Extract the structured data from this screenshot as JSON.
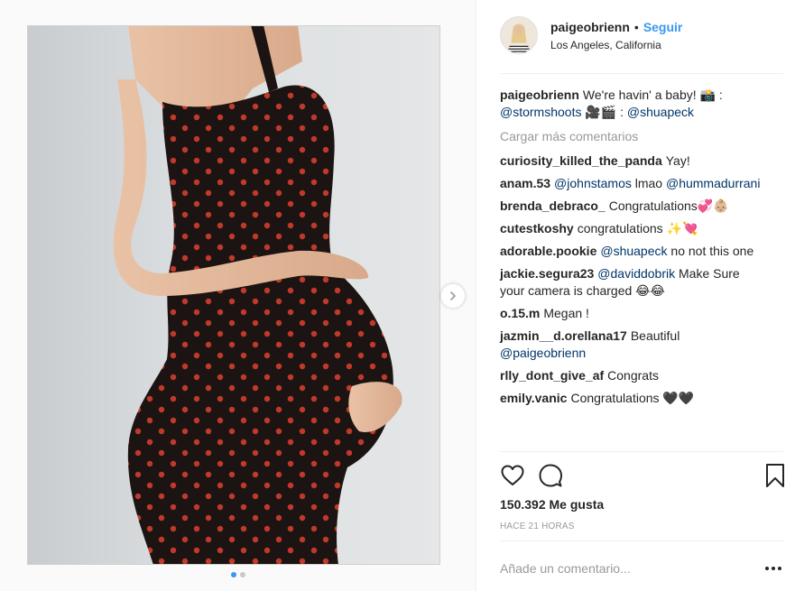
{
  "header": {
    "username": "paigeobrienn",
    "separator": "•",
    "follow_label": "Seguir",
    "location": "Los Angeles, California"
  },
  "caption": {
    "user": "paigeobrienn",
    "text": "We're havin' a baby! 📸 :",
    "mention1": "@stormshoots",
    "middle": " 🎥🎬 : ",
    "mention2": "@shuapeck"
  },
  "load_more_label": "Cargar más comentarios",
  "comments": [
    {
      "user": "curiosity_killed_the_panda",
      "text": "Yay!"
    },
    {
      "user": "anam.53",
      "mention": "@johnstamos",
      "text": " lmao ",
      "mention2": "@hummadurrani"
    },
    {
      "user": "brenda_debraco_",
      "text": "Congratulations💞👶🏼"
    },
    {
      "user": "cutestkoshy",
      "text": "congratulations ✨💘"
    },
    {
      "user": "adorable.pookie",
      "mention": "@shuapeck",
      "text": " no not this one"
    },
    {
      "user": "jackie.segura23",
      "mention": "@daviddobrik",
      "text": " Make Sure your camera is charged 😂😂"
    },
    {
      "user": "o.15.m",
      "text": "Megan !"
    },
    {
      "user": "jazmin__d.orellana17",
      "text": "Beautiful ",
      "mention": "@paigeobrienn"
    },
    {
      "user": "rlly_dont_give_af",
      "text": "Congrats"
    },
    {
      "user": "emily.vanic",
      "text": "Congratulations 🖤🖤"
    }
  ],
  "likes_label": "150.392 Me gusta",
  "time_label": "HACE 21 HORAS",
  "add_comment_placeholder": "Añade un comentario...",
  "carousel": {
    "count": 2,
    "active": 0
  },
  "icons": [
    "heart-icon",
    "comment-icon",
    "bookmark-icon",
    "chevron-right-icon",
    "more-icon"
  ],
  "colors": {
    "link": "#3897f0",
    "mention": "#003569",
    "muted": "#999999",
    "text": "#262626"
  }
}
